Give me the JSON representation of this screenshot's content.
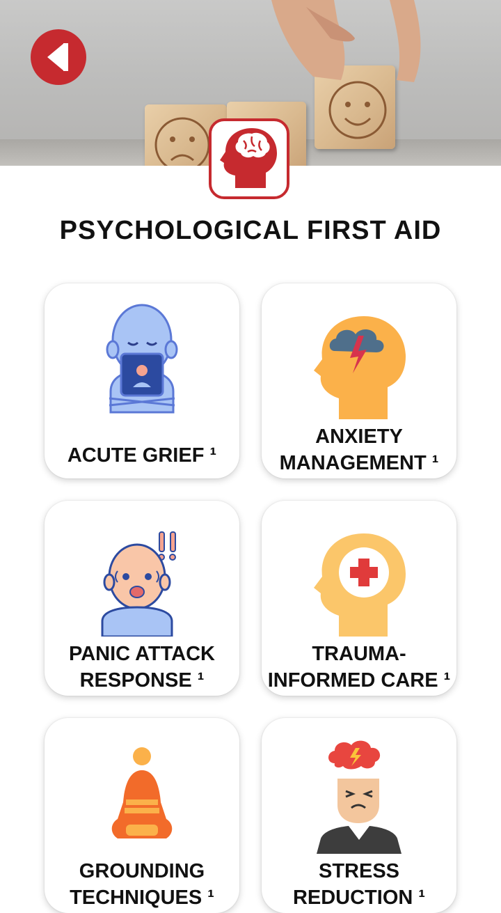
{
  "header": {
    "back_icon": "back-arrow-icon",
    "logo_icon": "brain-head-icon",
    "accent_color": "#c62a2f"
  },
  "page": {
    "title": "PSYCHOLOGICAL FIRST AID"
  },
  "cards": [
    {
      "label_lines": [
        "ACUTE GRIEF ¹"
      ],
      "icon": "grieving-person-icon"
    },
    {
      "label_lines": [
        "ANXIETY",
        "MANAGEMENT ¹"
      ],
      "icon": "storm-head-icon"
    },
    {
      "label_lines": [
        "PANIC ATTACK",
        "RESPONSE ¹"
      ],
      "icon": "panicked-person-icon"
    },
    {
      "label_lines": [
        "TRAUMA-",
        "INFORMED CARE ¹"
      ],
      "icon": "medical-head-icon"
    },
    {
      "label_lines": [
        "GROUNDING",
        "TECHNIQUES ¹"
      ],
      "icon": "meditating-person-icon"
    },
    {
      "label_lines": [
        "STRESS",
        "REDUCTION ¹"
      ],
      "icon": "stressed-person-icon"
    }
  ]
}
